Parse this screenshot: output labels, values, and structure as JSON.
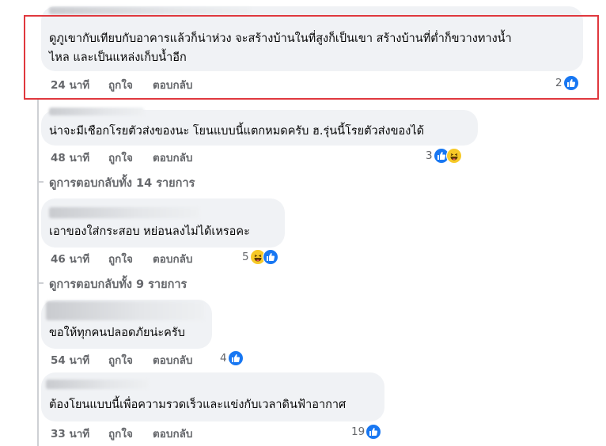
{
  "colors": {
    "bubble": "#f0f2f5",
    "meta_text": "#65676b",
    "like_blue": "#1877f2",
    "highlight_red": "#e0383e"
  },
  "comments": [
    {
      "text_lines": [
        "ดูภูเขากับเทียบกับอาคารแล้วก็น่าห่วง จะสร้างบ้านในที่สูงก็เป็นเขา สร้างบ้านที่ต่ำก็ขวางทางน้ำ",
        "ไหล และเป็นแหล่งเก็บน้ำอีก"
      ],
      "time": "24 นาที",
      "like_label": "ถูกใจ",
      "reply_label": "ตอบกลับ",
      "reaction_count": "2",
      "reactions": [
        "like-icon"
      ]
    },
    {
      "text_lines": [
        "น่าจะมีเชือกโรยตัวส่งของนะ โยนแบบนี้แตกหมดครับ ฮ.รุ่นนี้โรยตัวส่งของได้"
      ],
      "time": "48 นาที",
      "like_label": "ถูกใจ",
      "reply_label": "ตอบกลับ",
      "reaction_count": "3",
      "reactions": [
        "like-icon",
        "haha-icon"
      ]
    },
    {
      "text_lines": [
        "เอาของใส่กระสอบ หย่อนลงไม่ได้เหรอคะ"
      ],
      "time": "46 นาที",
      "like_label": "ถูกใจ",
      "reply_label": "ตอบกลับ",
      "reaction_count": "5",
      "reactions": [
        "haha-icon",
        "like-icon"
      ]
    },
    {
      "text_lines": [
        "ขอให้ทุกคนปลอดภัยน่ะครับ"
      ],
      "time": "54 นาที",
      "like_label": "ถูกใจ",
      "reply_label": "ตอบกลับ",
      "reaction_count": "4",
      "reactions": [
        "like-icon"
      ]
    },
    {
      "text_lines": [
        "ต้องโยนแบบนี้เพื่อความรวดเร็วและแข่งกับเวลาดินฟ้าอากาศ"
      ],
      "time": "33 นาที",
      "like_label": "ถูกใจ",
      "reply_label": "ตอบกลับ",
      "reaction_count": "19",
      "reactions": [
        "like-icon"
      ]
    }
  ],
  "view_replies": [
    "ดูการตอบกลับทั้ง 14 รายการ",
    "ดูการตอบกลับทั้ง 9 รายการ"
  ]
}
